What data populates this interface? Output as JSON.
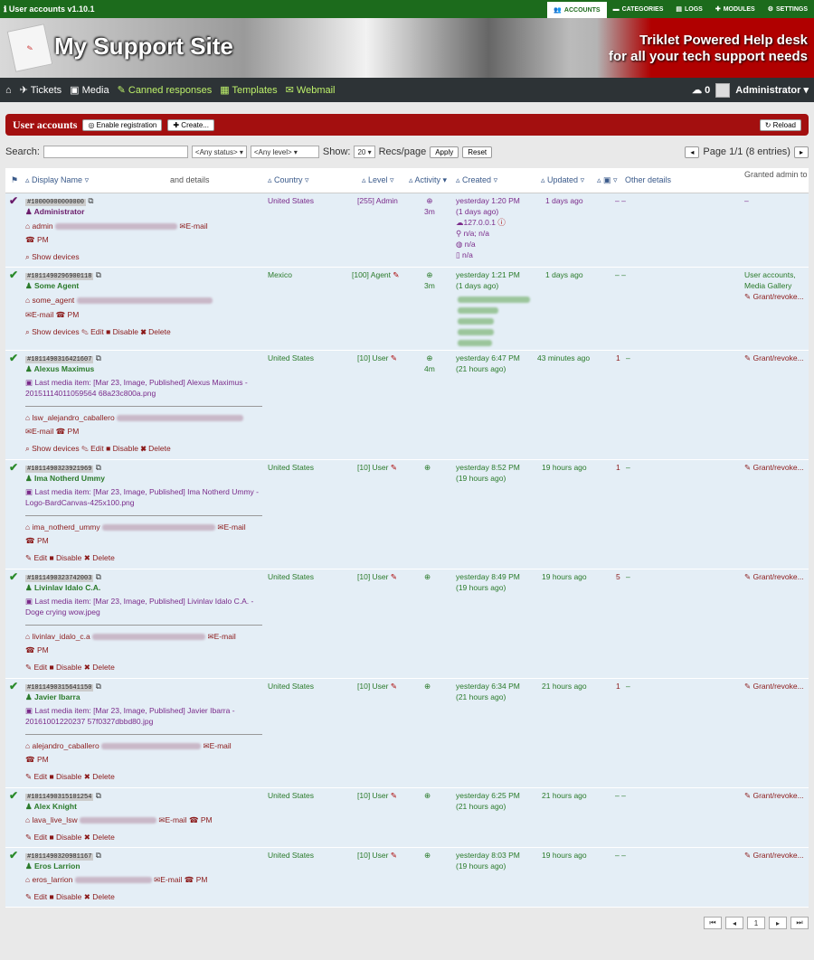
{
  "app": {
    "title": "User accounts v1.10.1"
  },
  "topnav": [
    {
      "label": "Accounts"
    },
    {
      "label": "Categories"
    },
    {
      "label": "Logs"
    },
    {
      "label": "Modules"
    },
    {
      "label": "Settings"
    }
  ],
  "banner": {
    "site": "My Support Site",
    "tagline1": "Triklet Powered Help desk",
    "tagline2": "for all your tech support needs"
  },
  "menu": {
    "items": [
      "Tickets",
      "Media",
      "Canned responses",
      "Templates",
      "Webmail"
    ],
    "notifications": "0",
    "user": "Administrator"
  },
  "panel": {
    "title": "User accounts",
    "enable": "Enable registration",
    "create": "Create...",
    "reload": "Reload"
  },
  "filters": {
    "search_label": "Search:",
    "status": "<Any status>",
    "level": "<Any level>",
    "show": "Show:",
    "recs": "20",
    "per_page": "Recs/page",
    "apply": "Apply",
    "reset": "Reset",
    "page": "Page 1/1 (8 entries)"
  },
  "headers": {
    "display_name": "Display Name",
    "and_details": "and details",
    "country": "Country",
    "level": "Level",
    "activity": "Activity",
    "created": "Created",
    "updated": "Updated",
    "other": "Other details",
    "granted": "Granted admin to"
  },
  "rows": [
    {
      "id": "#10000000000000",
      "name": "Administrator",
      "user": "admin",
      "country": "United States",
      "level": "[255] Admin",
      "activity": "3m",
      "created": "yesterday 1:20 PM",
      "created2": "(1 days ago)",
      "updated": "1 days ago",
      "other": "–  –",
      "granted": "–",
      "ip": "127.0.0.1",
      "loc": "n/a; n/a",
      "os": "n/a",
      "dev": "n/a",
      "email": "E-mail",
      "pm": "PM",
      "show": "Show devices"
    },
    {
      "id": "#1011490296900118",
      "name": "Some Agent",
      "user": "some_agent",
      "country": "Mexico",
      "level": "[100] Agent",
      "activity": "3m",
      "created": "yesterday 1:21 PM",
      "created2": "(1 days ago)",
      "updated": "1 days ago",
      "other": "–  –",
      "granted": "User accounts, Media Gallery",
      "grant": "Grant/revoke...",
      "email": "E-mail",
      "pm": "PM",
      "show": "Show devices",
      "edit": "Edit",
      "disable": "Disable",
      "delete": "Delete"
    },
    {
      "id": "#1011490316421607",
      "name": "Alexus Maximus",
      "user": "lsw_alejandro_caballero",
      "country": "United States",
      "level": "[10] User",
      "activity": "4m",
      "created": "yesterday 6:47 PM",
      "created2": "(21 hours ago)",
      "updated": "43 minutes ago",
      "count": "1",
      "other": "–",
      "grant": "Grant/revoke...",
      "media_prefix": "Last media item: [Mar 23, Image, Published]",
      "media_link": "Alexus Maximus - 20151114011059564 68a23c800a.png",
      "email": "E-mail",
      "pm": "PM",
      "show": "Show devices",
      "edit": "Edit",
      "disable": "Disable",
      "delete": "Delete"
    },
    {
      "id": "#1011490323921969",
      "name": "Ima Notherd Ummy",
      "user": "ima_notherd_ummy",
      "country": "United States",
      "level": "[10] User",
      "created": "yesterday 8:52 PM",
      "created2": "(19 hours ago)",
      "updated": "19 hours ago",
      "count": "1",
      "other": "–",
      "grant": "Grant/revoke...",
      "media_prefix": "Last media item: [Mar 23, Image, Published]",
      "media_link": "Ima Notherd Ummy - Logo-BardCanvas-425x100.png",
      "email": "E-mail",
      "pm": "PM",
      "edit": "Edit",
      "disable": "Disable",
      "delete": "Delete"
    },
    {
      "id": "#1011490323742003",
      "name": "Livinlav Idalo C.A.",
      "user": "livinlav_idalo_c.a",
      "country": "United States",
      "level": "[10] User",
      "created": "yesterday 8:49 PM",
      "created2": "(19 hours ago)",
      "updated": "19 hours ago",
      "count": "5",
      "other": "–",
      "grant": "Grant/revoke...",
      "media_prefix": "Last media item: [Mar 23, Image, Published]",
      "media_link": "Livinlav Idalo C.A. - Doge crying wow.jpeg",
      "email": "E-mail",
      "pm": "PM",
      "edit": "Edit",
      "disable": "Disable",
      "delete": "Delete"
    },
    {
      "id": "#1011490315641150",
      "name": "Javier Ibarra",
      "user": "alejandro_caballero",
      "country": "United States",
      "level": "[10] User",
      "created": "yesterday 6:34 PM",
      "created2": "(21 hours ago)",
      "updated": "21 hours ago",
      "count": "1",
      "other": "–",
      "grant": "Grant/revoke...",
      "media_prefix": "Last media item: [Mar 23, Image, Published]",
      "media_link": "Javier Ibarra - 20161001220237 57f0327dbbd80.jpg",
      "email": "E-mail",
      "pm": "PM",
      "edit": "Edit",
      "disable": "Disable",
      "delete": "Delete"
    },
    {
      "id": "#1011490315101254",
      "name": "Alex Knight",
      "user": "lava_live_lsw",
      "country": "United States",
      "level": "[10] User",
      "created": "yesterday 6:25 PM",
      "created2": "(21 hours ago)",
      "updated": "21 hours ago",
      "other": "–  –",
      "grant": "Grant/revoke...",
      "email": "E-mail",
      "pm": "PM",
      "edit": "Edit",
      "disable": "Disable",
      "delete": "Delete"
    },
    {
      "id": "#1011490320981167",
      "name": "Eros Larrion",
      "user": "eros_larrion",
      "country": "United States",
      "level": "[10] User",
      "created": "yesterday 8:03 PM",
      "created2": "(19 hours ago)",
      "updated": "19 hours ago",
      "other": "–  –",
      "grant": "Grant/revoke...",
      "email": "E-mail",
      "pm": "PM",
      "edit": "Edit",
      "disable": "Disable",
      "delete": "Delete"
    }
  ],
  "pager_bottom": {
    "page": "1"
  },
  "colors": {
    "topbar": "#1c6b1c",
    "panel": "#a30f0f",
    "menubar": "#2d3336",
    "row": "#e4eef6"
  }
}
